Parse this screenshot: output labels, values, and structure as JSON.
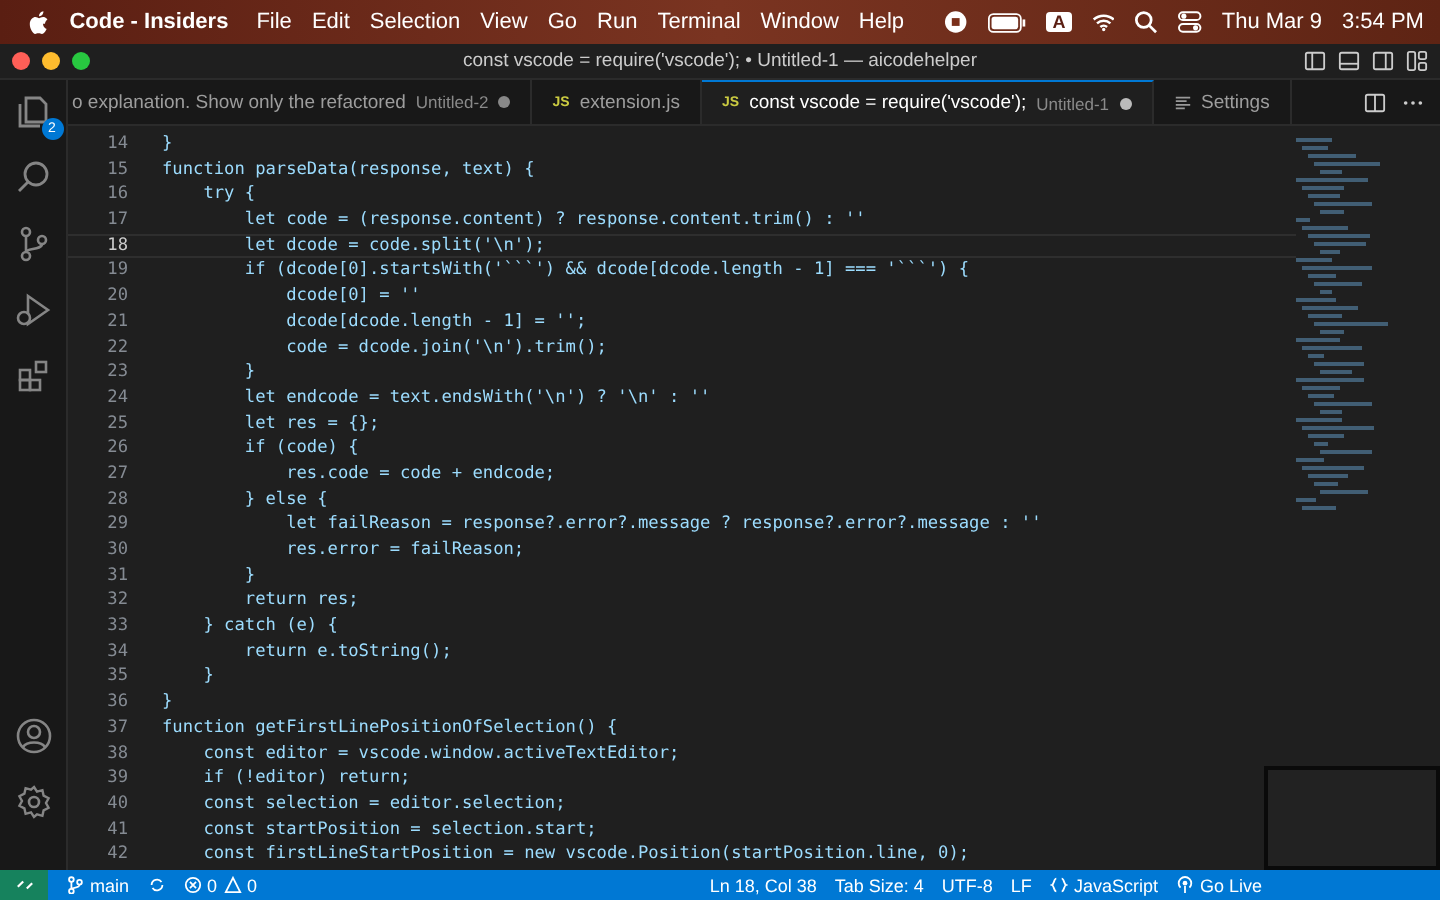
{
  "menu_bar": {
    "app": "Code - Insiders",
    "items": [
      "File",
      "Edit",
      "Selection",
      "View",
      "Go",
      "Run",
      "Terminal",
      "Window",
      "Help"
    ],
    "input_source": "A",
    "date": "Thu Mar 9",
    "time": "3:54 PM"
  },
  "window": {
    "title": "const vscode = require('vscode'); • Untitled-1 — aicodehelper"
  },
  "activity_bar": {
    "explorer_badge": "2"
  },
  "tabs": [
    {
      "kind": "file",
      "label": "o explanation. Show only the refactored",
      "description": "Untitled-2",
      "dirty": true,
      "selected": false
    },
    {
      "kind": "file",
      "icon_text": "JS",
      "label": "extension.js",
      "dirty": false,
      "selected": false
    },
    {
      "kind": "file",
      "icon_text": "JS",
      "label": "const vscode = require('vscode');",
      "description": "Untitled-1",
      "dirty": true,
      "selected": true
    },
    {
      "kind": "settings",
      "label": "Settings",
      "dirty": false,
      "selected": false
    }
  ],
  "editor": {
    "lines": [
      {
        "number": "14",
        "text": "}",
        "current": false
      },
      {
        "number": "15",
        "text": "function parseData(response, text) {",
        "current": false
      },
      {
        "number": "16",
        "text": "    try {",
        "current": false
      },
      {
        "number": "17",
        "text": "        let code = (response.content) ? response.content.trim() : ''",
        "current": false
      },
      {
        "number": "18",
        "text": "        let dcode = code.split('\\n');",
        "current": true
      },
      {
        "number": "19",
        "text": "        if (dcode[0].startsWith('```') && dcode[dcode.length - 1] === '```') {",
        "current": false
      },
      {
        "number": "20",
        "text": "            dcode[0] = ''",
        "current": false
      },
      {
        "number": "21",
        "text": "            dcode[dcode.length - 1] = '';",
        "current": false
      },
      {
        "number": "22",
        "text": "            code = dcode.join('\\n').trim();",
        "current": false
      },
      {
        "number": "23",
        "text": "        }",
        "current": false
      },
      {
        "number": "24",
        "text": "        let endcode = text.endsWith('\\n') ? '\\n' : ''",
        "current": false
      },
      {
        "number": "25",
        "text": "        let res = {};",
        "current": false
      },
      {
        "number": "26",
        "text": "        if (code) {",
        "current": false
      },
      {
        "number": "27",
        "text": "            res.code = code + endcode;",
        "current": false
      },
      {
        "number": "28",
        "text": "        } else {",
        "current": false
      },
      {
        "number": "29",
        "text": "            let failReason = response?.error?.message ? response?.error?.message : ''",
        "current": false
      },
      {
        "number": "30",
        "text": "            res.error = failReason;",
        "current": false
      },
      {
        "number": "31",
        "text": "        }",
        "current": false
      },
      {
        "number": "32",
        "text": "        return res;",
        "current": false
      },
      {
        "number": "33",
        "text": "    } catch (e) {",
        "current": false
      },
      {
        "number": "34",
        "text": "        return e.toString();",
        "current": false
      },
      {
        "number": "35",
        "text": "    }",
        "current": false
      },
      {
        "number": "36",
        "text": "}",
        "current": false
      },
      {
        "number": "37",
        "text": "function getFirstLinePositionOfSelection() {",
        "current": false
      },
      {
        "number": "38",
        "text": "    const editor = vscode.window.activeTextEditor;",
        "current": false
      },
      {
        "number": "39",
        "text": "    if (!editor) return;",
        "current": false
      },
      {
        "number": "40",
        "text": "    const selection = editor.selection;",
        "current": false
      },
      {
        "number": "41",
        "text": "    const startPosition = selection.start;",
        "current": false
      },
      {
        "number": "42",
        "text": "    const firstLineStartPosition = new vscode.Position(startPosition.line, 0);",
        "current": false
      }
    ]
  },
  "status_bar": {
    "branch": "main",
    "errors": "0",
    "warnings": "0",
    "position": "Ln 18, Col 38",
    "tab_size": "Tab Size: 4",
    "encoding": "UTF-8",
    "eol": "LF",
    "language": "JavaScript",
    "go_live": "Go Live"
  }
}
